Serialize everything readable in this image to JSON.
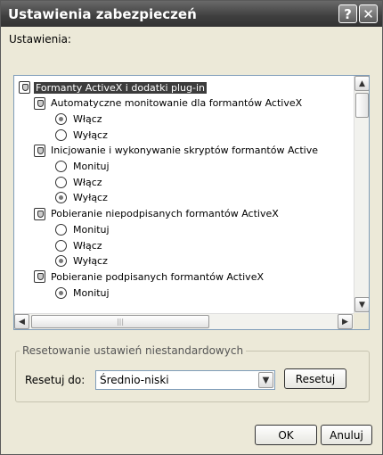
{
  "window": {
    "title": "Ustawienia zabezpieczeń",
    "help_glyph": "?",
    "close_glyph": "✕"
  },
  "settings_label": "Ustawienia:",
  "tree": [
    {
      "kind": "category",
      "label": "Formanty ActiveX i dodatki plug-in",
      "selected": true
    },
    {
      "kind": "setting",
      "label": "Automatyczne monitowanie dla formantów ActiveX"
    },
    {
      "kind": "option",
      "label": "Włącz",
      "checked": true
    },
    {
      "kind": "option",
      "label": "Wyłącz",
      "checked": false
    },
    {
      "kind": "setting",
      "label": "Inicjowanie i wykonywanie skryptów formantów Active"
    },
    {
      "kind": "option",
      "label": "Monituj",
      "checked": false
    },
    {
      "kind": "option",
      "label": "Włącz",
      "checked": false
    },
    {
      "kind": "option",
      "label": "Wyłącz",
      "checked": true
    },
    {
      "kind": "setting",
      "label": "Pobieranie niepodpisanych formantów ActiveX"
    },
    {
      "kind": "option",
      "label": "Monituj",
      "checked": false
    },
    {
      "kind": "option",
      "label": "Włącz",
      "checked": false
    },
    {
      "kind": "option",
      "label": "Wyłącz",
      "checked": true
    },
    {
      "kind": "setting",
      "label": "Pobieranie podpisanych formantów ActiveX"
    },
    {
      "kind": "option",
      "label": "Monituj",
      "checked": true
    }
  ],
  "scrollbar": {
    "up_arrow": "▲",
    "down_arrow": "▼",
    "left_arrow": "◀",
    "right_arrow": "▶",
    "grip": "|||"
  },
  "reset_group": {
    "title": "Resetowanie ustawień niestandardowych",
    "reset_to_label": "Resetuj do:",
    "selected_level": "Średnio-niski",
    "dropdown_arrow": "▼",
    "reset_button": "Resetuj"
  },
  "footer": {
    "ok_button": "OK",
    "cancel_button": "Anuluj"
  }
}
